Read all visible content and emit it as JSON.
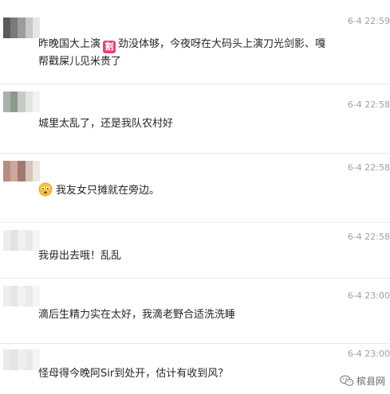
{
  "comments": [
    {
      "time": "6-4 22:59",
      "text_before": "昨晚国大上演",
      "badge": "割",
      "text_after": "劲没体够，今夜呀在大码头上演刀光剑影、嘎",
      "line2": "帮戳屎儿见米贵了",
      "avatar_colors": [
        "#5b5b5b",
        "#7a7a7a",
        "#9c9c9c",
        "#c8c8c8",
        "#e6e6e6"
      ]
    },
    {
      "time": "6-4 22:58",
      "text": "城里太乱了，还是我队农村好",
      "avatar_colors": [
        "#a9b2a8",
        "#8d9a8b",
        "#c5cbc3",
        "#e1e4df",
        "#f2f3f1"
      ]
    },
    {
      "time": "6-4 22:58",
      "text": "我友女只摊就在旁边。",
      "emoji": "worried-face",
      "avatar_colors": [
        "#b38e83",
        "#cda79c",
        "#a07a70",
        "#d9c4bd",
        "#efe5e1"
      ]
    },
    {
      "time": "6-4 22:58",
      "text": "我毋出去哦！乱乱",
      "avatar_colors": [
        "#ececec",
        "#e2e2e2",
        "#f0f0f0",
        "#e8e8e8",
        "#f5f5f5"
      ]
    },
    {
      "time": "6-4 23:00",
      "text": "滴后生精力实在太好，我滴老野合适洗洗睡",
      "avatar_colors": [
        "#eeeeee",
        "#e6e6e6",
        "#f2f2f2",
        "#eaeaea",
        "#f6f6f6"
      ]
    },
    {
      "time": "6-4 23:00",
      "text": "怪母得今晚阿Sir到处开，估计有收到风？",
      "avatar_colors": [
        "#eaeaea",
        "#e4e4e4",
        "#efefef",
        "#e8e8e8",
        "#f4f4f4"
      ]
    }
  ],
  "watermark": {
    "label": "槟县网",
    "icon": "wechat-icon"
  }
}
